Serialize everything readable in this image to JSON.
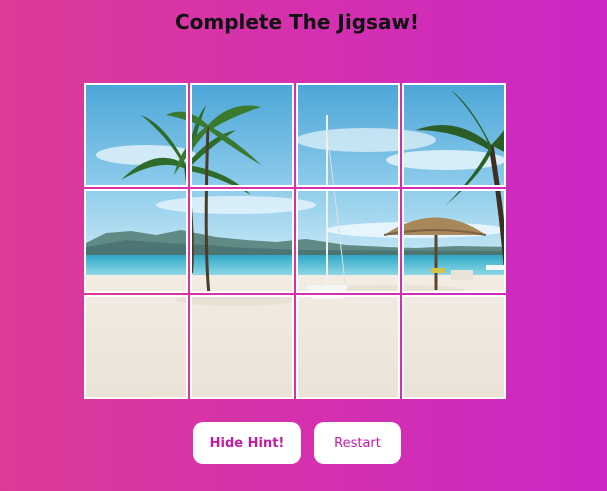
{
  "page": {
    "title": "Complete The Jigsaw!"
  },
  "controls": {
    "hint_label": "Hide Hint!",
    "restart_label": "Restart"
  },
  "puzzle": {
    "rows": 3,
    "columns": 4,
    "tiles": [
      {
        "row": 0,
        "col": 0
      },
      {
        "row": 0,
        "col": 1
      },
      {
        "row": 0,
        "col": 2
      },
      {
        "row": 0,
        "col": 3
      },
      {
        "row": 1,
        "col": 0
      },
      {
        "row": 1,
        "col": 1
      },
      {
        "row": 1,
        "col": 2
      },
      {
        "row": 1,
        "col": 3
      },
      {
        "row": 2,
        "col": 0
      },
      {
        "row": 2,
        "col": 1
      },
      {
        "row": 2,
        "col": 2
      },
      {
        "row": 2,
        "col": 3
      }
    ]
  },
  "colors": {
    "background_start": "#dd3a98",
    "background_end": "#cc27c5",
    "button_text": "#c41aa6",
    "tile_border": "#ffffff"
  }
}
